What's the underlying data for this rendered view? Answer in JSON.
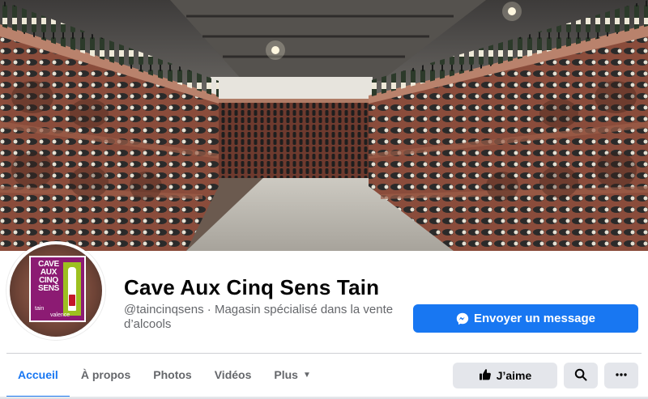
{
  "cover": {
    "alt": "wine cellar photo"
  },
  "profile": {
    "logo_text": "CAVE\nAUX\nCINQ\nSENS",
    "logo_tain": "tain",
    "logo_valence": "valence"
  },
  "page": {
    "title": "Cave Aux Cinq Sens Tain",
    "subtitle": "@taincinqsens · Magasin spécialisé dans la vente d’alcools"
  },
  "actions": {
    "message_label": "Envoyer un message",
    "like_label": "J’aime"
  },
  "tabs": [
    {
      "label": "Accueil",
      "active": true
    },
    {
      "label": "À propos"
    },
    {
      "label": "Photos"
    },
    {
      "label": "Vidéos"
    },
    {
      "label": "Plus"
    }
  ],
  "icons": {
    "message": "messenger-icon",
    "like": "thumbs-up-icon",
    "search": "search-icon",
    "more": "ellipsis-icon",
    "dropdown": "caret-down-icon"
  },
  "colors": {
    "accent": "#1877f2",
    "button_gray": "#e4e6eb",
    "secondary_text": "#65676b",
    "logo_purple": "#8c1b73",
    "logo_green": "#9dc020"
  }
}
